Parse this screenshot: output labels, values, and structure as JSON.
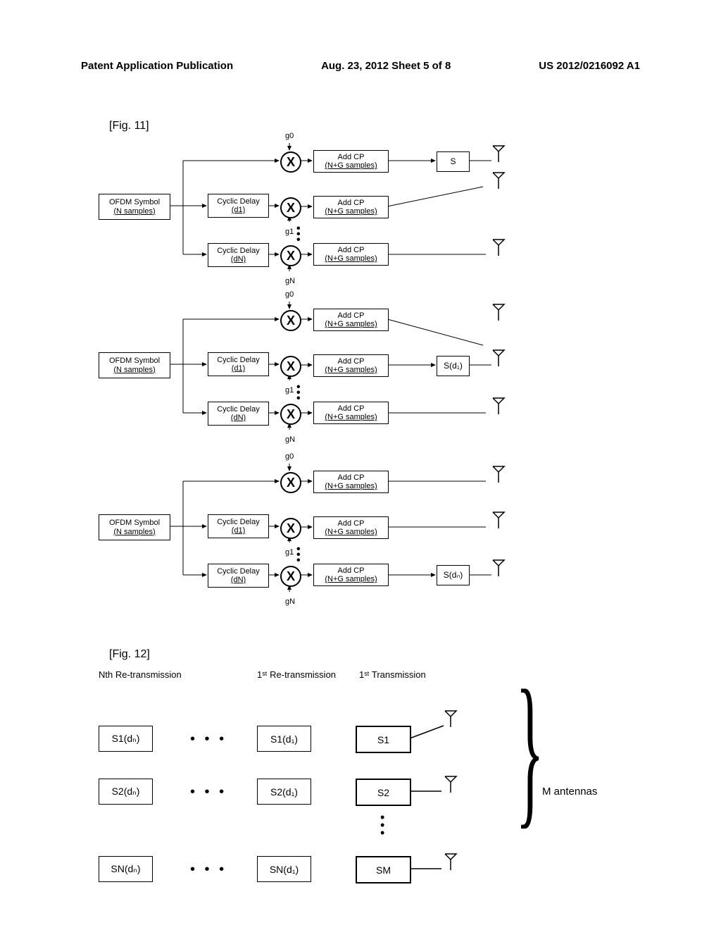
{
  "header": {
    "left": "Patent Application Publication",
    "center": "Aug. 23, 2012  Sheet 5 of 8",
    "right": "US 2012/0216092 A1"
  },
  "figures": {
    "fig11": {
      "label": "[Fig. 11]",
      "ofdm": {
        "line1": "OFDM Symbol",
        "line2": "(N samples)"
      },
      "delay_d1": {
        "line1": "Cyclic Delay",
        "line2": "(d1)"
      },
      "delay_dN": {
        "line1": "Cyclic Delay",
        "line2": "(dN)"
      },
      "gains": {
        "g0": "g0",
        "g1": "g1",
        "gN": "gN"
      },
      "mult": "X",
      "addcp": {
        "line1": "Add CP",
        "line2": "(N+G samples)"
      },
      "s_labels": {
        "s": "S",
        "sd1": "S(d₁)",
        "sdN": "S(dₙ)"
      }
    },
    "fig12": {
      "label": "[Fig. 12]",
      "headings": {
        "nth": "Nth Re-transmission",
        "first_re": "1ˢᵗ Re-transmission",
        "first_tx": "1ˢᵗ Transmission"
      },
      "boxes": {
        "s1dN": "S1(dₙ)",
        "s2dN": "S2(dₙ)",
        "sNdN": "SN(dₙ)",
        "s1d1": "S1(d₁)",
        "s2d1": "S2(d₁)",
        "sNd1": "SN(d₁)",
        "s1": "S1",
        "s2": "S2",
        "sM": "SM"
      },
      "m_antennas": "M antennas",
      "dots": "• • •"
    }
  }
}
